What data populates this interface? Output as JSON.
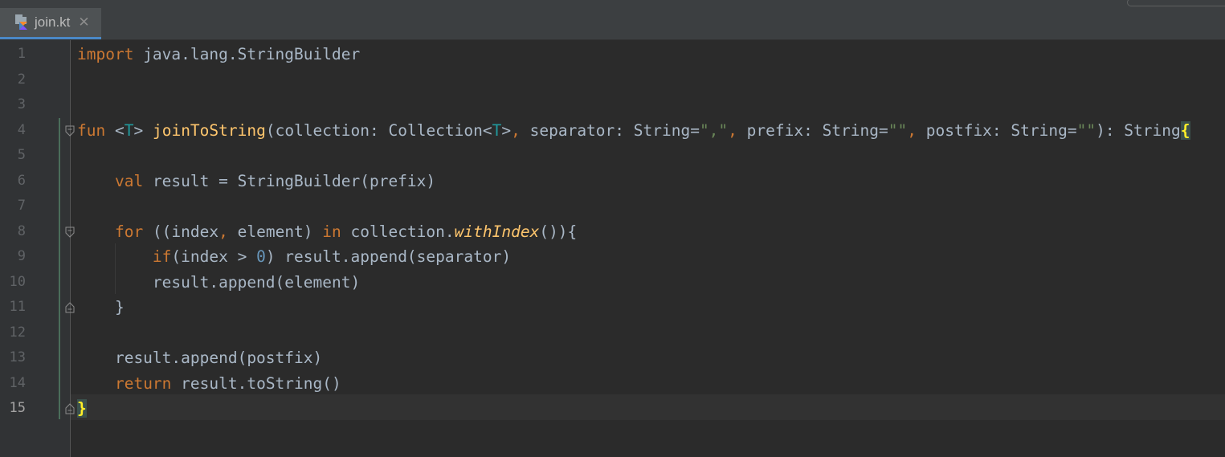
{
  "tab": {
    "file_name": "join.kt",
    "close_glyph": "✕",
    "icon": "kotlin-file-icon"
  },
  "gutter": {
    "line_numbers": [
      "1",
      "2",
      "3",
      "4",
      "5",
      "6",
      "7",
      "8",
      "9",
      "10",
      "11",
      "12",
      "13",
      "14",
      "15"
    ],
    "current_line": "15"
  },
  "code": {
    "line1": {
      "kw": "import",
      "rest": " java.lang.StringBuilder"
    },
    "line4": {
      "kw": "fun",
      "sp1": " ",
      "lt": "<",
      "tp": "T",
      "gt": "> ",
      "fn": "joinToString",
      "p1": "(collection: Collection<",
      "tp2": "T",
      "p2": ">",
      "c1": ",",
      "p3": " separator: String=",
      "s1": "\",\"",
      "c2": ",",
      "p4": " prefix: String=",
      "s2": "\"\"",
      "c3": ",",
      "p5": " postfix: String=",
      "s3": "\"\"",
      "p6": "): String",
      "brace": "{"
    },
    "line6": {
      "indent": "    ",
      "kw": "val",
      "rest": " result = StringBuilder(prefix)"
    },
    "line8": {
      "indent": "    ",
      "kw": "for",
      "p1": " ((index",
      "c1": ",",
      "p2": " element) ",
      "kw2": "in",
      "p3": " collection.",
      "fn": "withIndex",
      "p4": "()){"
    },
    "line9": {
      "indent": "        ",
      "kw": "if",
      "p1": "(index > ",
      "num": "0",
      "p2": ") result.append(separator)"
    },
    "line10": {
      "text": "        result.append(element)"
    },
    "line11": {
      "text": "    }"
    },
    "line13": {
      "text": "    result.append(postfix)"
    },
    "line14": {
      "indent": "    ",
      "kw": "return",
      "rest": " result.toString()"
    },
    "line15": {
      "brace": "}"
    }
  },
  "colors": {
    "keyword": "#cc7832",
    "function": "#ffc66d",
    "type_param": "#20999d",
    "string": "#6a8759",
    "number": "#6897bb",
    "text": "#a9b7c6",
    "matched_brace": "#ffef28",
    "tab_underline": "#4a88c7"
  }
}
